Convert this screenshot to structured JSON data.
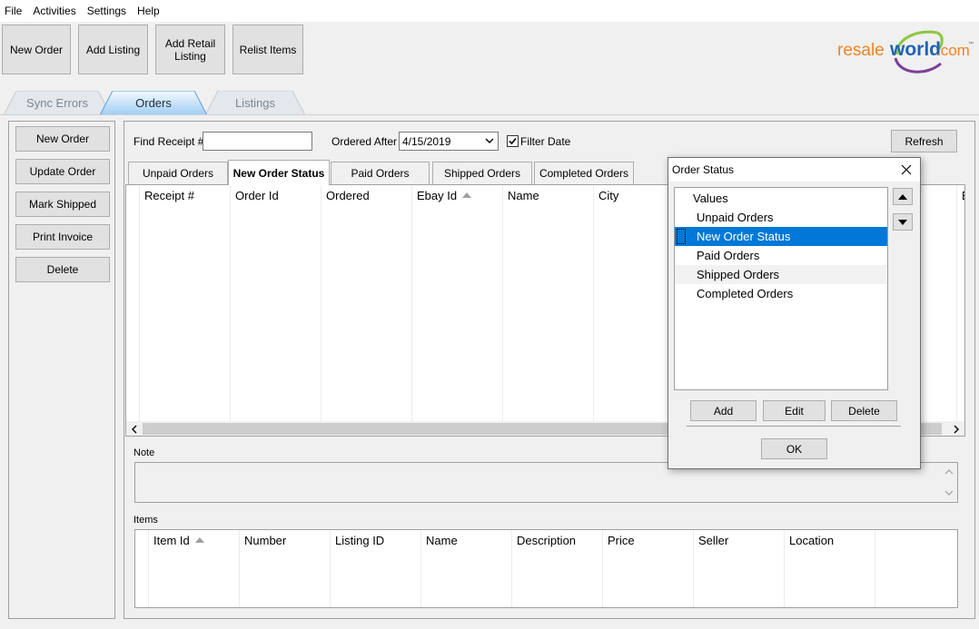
{
  "menu": [
    "File",
    "Activities",
    "Settings",
    "Help"
  ],
  "toolbar": {
    "new_order": "New Order",
    "add_listing": "Add Listing",
    "add_retail_listing": "Add Retail Listing",
    "relist_items": "Relist Items"
  },
  "logo": {
    "part1": "resale",
    "part2": "world",
    "part3": ".com",
    "trademark": "™"
  },
  "main_tabs": [
    "Sync Errors",
    "Orders",
    "Listings"
  ],
  "side_buttons": [
    "New Order",
    "Update Order",
    "Mark Shipped",
    "Print Invoice",
    "Delete"
  ],
  "filters": {
    "find_receipt_label": "Find Receipt #",
    "find_receipt_value": "",
    "ordered_after_label": "Ordered After",
    "ordered_after_value": "4/15/2019",
    "filter_date_label": "Filter Date",
    "filter_date_checked": true,
    "refresh": "Refresh"
  },
  "status_tabs": [
    "Unpaid Orders",
    "New Order Status",
    "Paid Orders",
    "Shipped Orders",
    "Completed Orders"
  ],
  "orders_grid": {
    "columns": [
      "Receipt #",
      "Order Id",
      "Ordered",
      "Ebay Id",
      "Name",
      "City"
    ],
    "truncated_col": "E"
  },
  "note_label": "Note",
  "items_label": "Items",
  "items_grid": {
    "columns": [
      "Item Id",
      "Number",
      "Listing ID",
      "Name",
      "Description",
      "Price",
      "Seller",
      "Location"
    ]
  },
  "dialog": {
    "title": "Order Status",
    "header": "Values",
    "items": [
      "Unpaid Orders",
      "New Order Status",
      "Paid Orders",
      "Shipped Orders",
      "Completed Orders"
    ],
    "selected_index": 1,
    "add": "Add",
    "edit": "Edit",
    "delete": "Delete",
    "ok": "OK"
  },
  "colors": {
    "accent_blue": "#0078d7",
    "logo_orange": "#f5821f",
    "logo_blue": "#1c63b7",
    "logo_green": "#8cc63f",
    "logo_purple": "#7b3f98"
  }
}
